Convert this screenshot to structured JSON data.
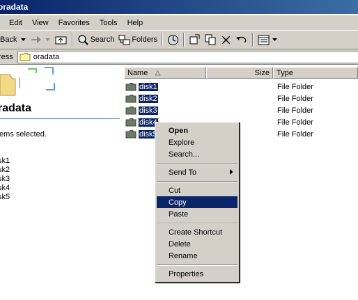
{
  "window": {
    "title": "oradata"
  },
  "menu": [
    "Edit",
    "View",
    "Favorites",
    "Tools",
    "Help"
  ],
  "toolbar": {
    "back": "Back",
    "search": "Search",
    "folders": "Folders"
  },
  "address": {
    "label": "ress",
    "value": "oradata"
  },
  "left_pane": {
    "folder_name": "radata",
    "selection_text": "tems selected.",
    "selected_items": [
      "sk1",
      "sk2",
      "sk3",
      "sk4",
      "sk5"
    ]
  },
  "columns": {
    "name": "Name",
    "size": "Size",
    "type": "Type"
  },
  "files": [
    {
      "name": "disk1",
      "type": "File Folder"
    },
    {
      "name": "disk2",
      "type": "File Folder"
    },
    {
      "name": "disk3",
      "type": "File Folder"
    },
    {
      "name": "disk4",
      "type": "File Folder"
    },
    {
      "name": "disk5",
      "type": "File Folder"
    }
  ],
  "context_menu": {
    "open": "Open",
    "explore": "Explore",
    "search": "Search...",
    "send_to": "Send To",
    "cut": "Cut",
    "copy": "Copy",
    "paste": "Paste",
    "create_shortcut": "Create Shortcut",
    "delete": "Delete",
    "rename": "Rename",
    "properties": "Properties"
  },
  "colors": {
    "selection": "#0a246a",
    "face": "#d4d0c8"
  }
}
